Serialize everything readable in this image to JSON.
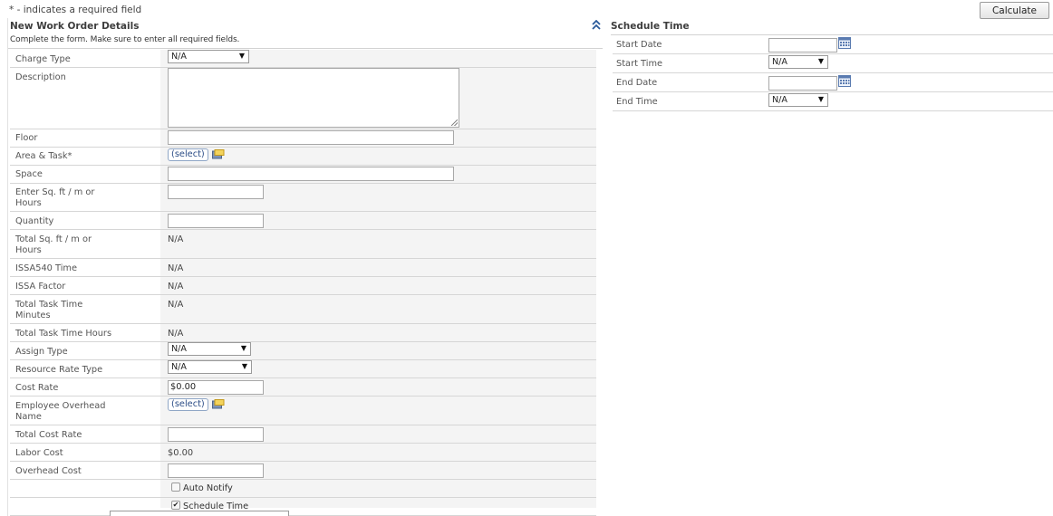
{
  "required_note": "* - indicates a required field",
  "calculate_label": "Calculate",
  "form": {
    "title": "New Work Order Details",
    "subtitle": "Complete the form. Make sure to enter all required fields.",
    "charge_type": {
      "label": "Charge Type",
      "value": "N/A"
    },
    "description": {
      "label": "Description",
      "value": ""
    },
    "floor": {
      "label": "Floor",
      "value": ""
    },
    "area_task": {
      "label": "Area & Task*",
      "link": "(select)"
    },
    "space": {
      "label": "Space",
      "value": ""
    },
    "sqft_hours": {
      "label": "Enter Sq. ft / m or Hours",
      "value": ""
    },
    "quantity": {
      "label": "Quantity",
      "value": ""
    },
    "total_sqft": {
      "label": "Total Sq. ft / m or Hours",
      "value": "N/A"
    },
    "issa_time": {
      "label": "ISSA540 Time",
      "value": "N/A"
    },
    "issa_factor": {
      "label": "ISSA Factor",
      "value": "N/A"
    },
    "total_task_minutes": {
      "label": "Total Task Time Minutes",
      "value": "N/A"
    },
    "total_task_hours": {
      "label": "Total Task Time Hours",
      "value": "N/A"
    },
    "assign_type": {
      "label": "Assign Type",
      "value": "N/A"
    },
    "resource_rate_type": {
      "label": "Resource Rate Type",
      "value": "N/A"
    },
    "cost_rate": {
      "label": "Cost Rate",
      "value": "$0.00"
    },
    "employee_overhead": {
      "label": "Employee Overhead Name",
      "link": "(select)"
    },
    "total_cost_rate": {
      "label": "Total Cost Rate",
      "value": ""
    },
    "labor_cost": {
      "label": "Labor Cost",
      "value": "$0.00"
    },
    "overhead_cost": {
      "label": "Overhead Cost",
      "value": ""
    },
    "auto_notify": {
      "label": "Auto Notify",
      "checked": false
    },
    "schedule_time": {
      "label": "Schedule Time",
      "checked": true
    }
  },
  "schedule": {
    "title": "Schedule Time",
    "start_date": {
      "label": "Start Date",
      "value": ""
    },
    "start_time": {
      "label": "Start Time",
      "value": "N/A"
    },
    "end_date": {
      "label": "End Date",
      "value": ""
    },
    "end_time": {
      "label": "End Time",
      "value": "N/A"
    }
  },
  "icons": {
    "collapse": "double-chevron-up-icon",
    "folder": "folder-icon",
    "calendar": "calendar-icon",
    "dropdown": "dropdown-arrow-icon"
  },
  "colors": {
    "link": "#2b4c86",
    "row_border": "#d6d6d6",
    "value_bg": "#f4f4f4"
  }
}
